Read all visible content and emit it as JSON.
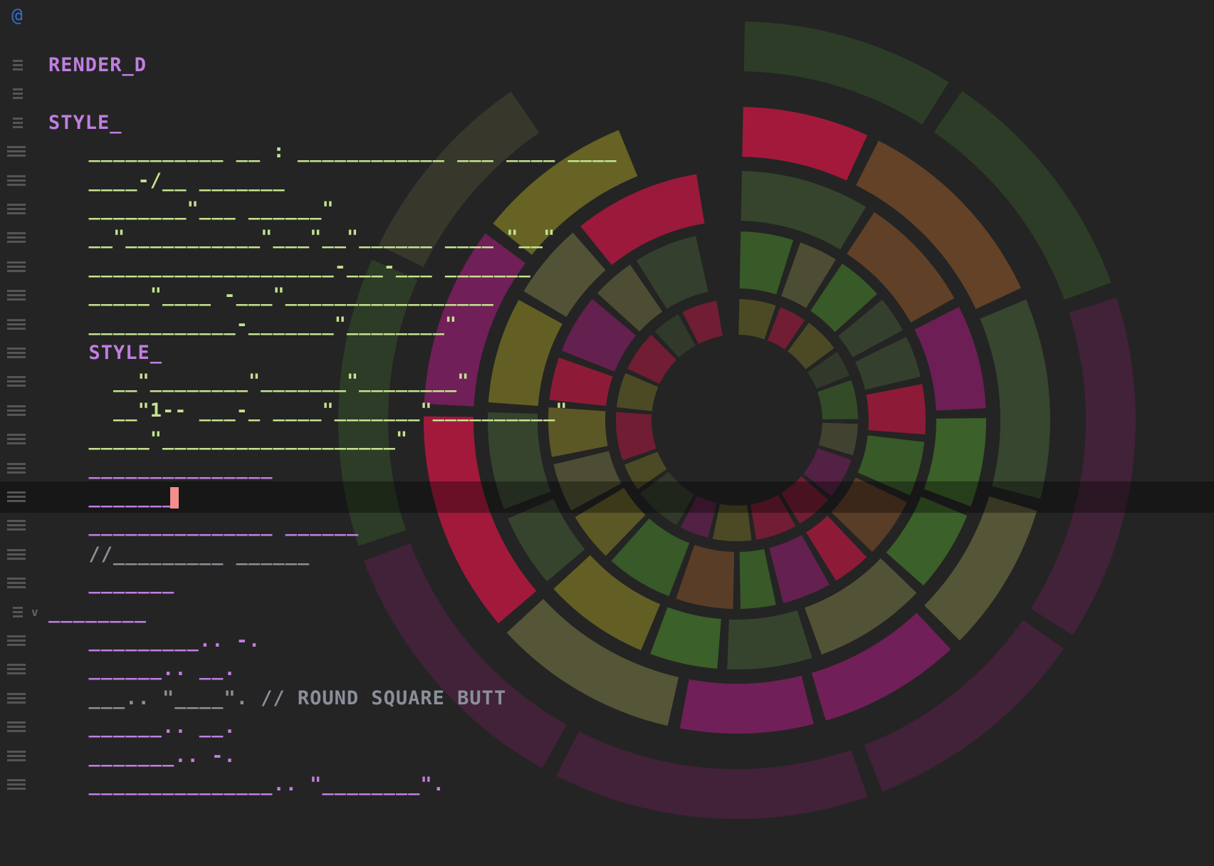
{
  "window": {
    "app_icon": "swirl-icon"
  },
  "colors": {
    "background": "#242424",
    "keyword": "#c07fe0",
    "string": "#c4e38f",
    "comment": "#8a8f9a",
    "cursor": "#f58d8d",
    "ring_magenta": "#7a1f5e",
    "ring_crimson": "#b0183f",
    "ring_green": "#3f6b2a",
    "ring_olive": "#6e6a25",
    "ring_brown": "#6b4628"
  },
  "editor": {
    "active_line": 15,
    "lines": [
      {
        "text": "RENDER_D",
        "cls": "k",
        "indent": 0
      },
      {
        "text": "",
        "cls": "k",
        "indent": 0
      },
      {
        "text": "STYLE_",
        "cls": "k",
        "indent": 0
      },
      {
        "text": "  ___________ __ : ____________ ___ ____ ____",
        "cls": "s",
        "indent": 1
      },
      {
        "text": "  ____-/__ _______",
        "cls": "s",
        "indent": 1
      },
      {
        "text": "  ________\"___ ______\"",
        "cls": "s",
        "indent": 1
      },
      {
        "text": "  __\"___________\"___\"__\"______ ____ \"__\"",
        "cls": "s",
        "indent": 1
      },
      {
        "text": "  ____________________-___-___ _______",
        "cls": "s",
        "indent": 1
      },
      {
        "text": "  _____\"____ -___\"_________________",
        "cls": "s",
        "indent": 1
      },
      {
        "text": "  ____________-_______\"________\"",
        "cls": "s",
        "indent": 1
      },
      {
        "text": "  STYLE_",
        "cls": "k",
        "indent": 1
      },
      {
        "text": "    __\"________\"_______\"________\"",
        "cls": "s",
        "indent": 2
      },
      {
        "text": "    __\"1-- ___-_ ____\"_______\"__________\"",
        "cls": "s",
        "indent": 2
      },
      {
        "text": "  _____\"___________________\"",
        "cls": "s",
        "indent": 1
      },
      {
        "text": "  _______________",
        "cls": "k",
        "indent": 1
      },
      {
        "text": "  _______",
        "cls": "k",
        "indent": 1
      },
      {
        "text": "  _______________ ______",
        "cls": "k",
        "indent": 1
      },
      {
        "text": "  //_________ ______",
        "cls": "c",
        "indent": 1
      },
      {
        "text": "  _______",
        "cls": "k",
        "indent": 1
      },
      {
        "text": "________",
        "cls": "k",
        "indent": 0
      },
      {
        "text": "  _________.. -.",
        "cls": "k",
        "indent": 1
      },
      {
        "text": "  ______.. __.",
        "cls": "k",
        "indent": 1
      },
      {
        "text": "  ___.. \"____\". // ROUND SQUARE BUTT",
        "cls": "c",
        "indent": 1
      },
      {
        "text": "  ______.. __.",
        "cls": "k",
        "indent": 1
      },
      {
        "text": "  _______.. -.",
        "cls": "k",
        "indent": 1
      },
      {
        "text": "  _______________.. \"________\".",
        "cls": "k",
        "indent": 1
      }
    ]
  },
  "chart_data": {
    "type": "sunburst",
    "rings": 4,
    "colors": [
      "#7a1f5e",
      "#b0183f",
      "#3f6b2a",
      "#6e6a25",
      "#6b4628",
      "#5b5b3a",
      "#3a4a30"
    ]
  }
}
